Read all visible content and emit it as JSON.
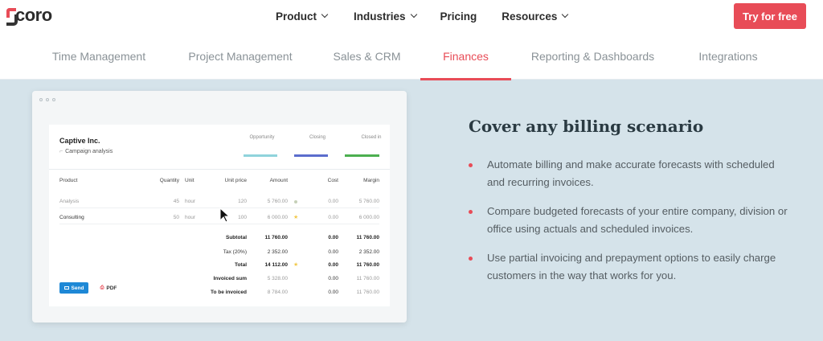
{
  "brand": {
    "name": "Scoro",
    "accent_color": "#e84c57"
  },
  "nav": {
    "items": [
      {
        "label": "Product",
        "has_dropdown": true
      },
      {
        "label": "Industries",
        "has_dropdown": true
      },
      {
        "label": "Pricing",
        "has_dropdown": false
      },
      {
        "label": "Resources",
        "has_dropdown": true
      }
    ],
    "cta_label": "Try for free"
  },
  "subnav": {
    "tabs": [
      {
        "label": "Time Management"
      },
      {
        "label": "Project Management"
      },
      {
        "label": "Sales & CRM"
      },
      {
        "label": "Finances",
        "active": true
      },
      {
        "label": "Reporting & Dashboards"
      },
      {
        "label": "Integrations"
      }
    ]
  },
  "invoice": {
    "company": "Captive Inc.",
    "project": "Campaign analysis",
    "stages": [
      {
        "label": "Opportunity",
        "color": "#8fd3dc"
      },
      {
        "label": "Closing",
        "color": "#5b6dcd"
      },
      {
        "label": "Closed in",
        "color": "#4caf50"
      }
    ],
    "columns": [
      "Product",
      "Quantity",
      "Unit",
      "Unit price",
      "Amount",
      "Cost",
      "Margin"
    ],
    "rows": [
      {
        "product": "Analysis",
        "quantity": "45",
        "unit": "hour",
        "unit_price": "120",
        "amount": "5 760.00",
        "cost": "0.00",
        "margin": "5 760.00"
      },
      {
        "product": "Consulting",
        "quantity": "50",
        "unit": "hour",
        "unit_price": "100",
        "amount": "6 000.00",
        "cost": "0.00",
        "margin": "6 000.00"
      }
    ],
    "summary": [
      {
        "label": "Subtotal",
        "amount": "11 760.00",
        "cost": "0.00",
        "margin": "11 760.00"
      },
      {
        "label": "Tax (20%)",
        "amount": "2 352.00",
        "cost": "0.00",
        "margin": "2 352.00"
      },
      {
        "label": "Total",
        "amount": "14 112.00",
        "cost": "0.00",
        "margin": "11 760.00"
      },
      {
        "label": "Invoiced sum",
        "amount": "5 328.00",
        "cost": "0.00",
        "margin": "11 760.00"
      },
      {
        "label": "To be invoiced",
        "amount": "8 784.00",
        "cost": "0.00",
        "margin": "11 760.00"
      }
    ],
    "send_label": "Send",
    "pdf_label": "PDF"
  },
  "content": {
    "heading": "Cover any billing scenario",
    "features": [
      "Automate billing and make accurate forecasts with scheduled and recurring invoices.",
      "Compare budgeted forecasts of your entire company, division or office using actuals and scheduled invoices.",
      "Use partial invoicing and prepayment options to easily charge customers in the way that works for you."
    ]
  }
}
